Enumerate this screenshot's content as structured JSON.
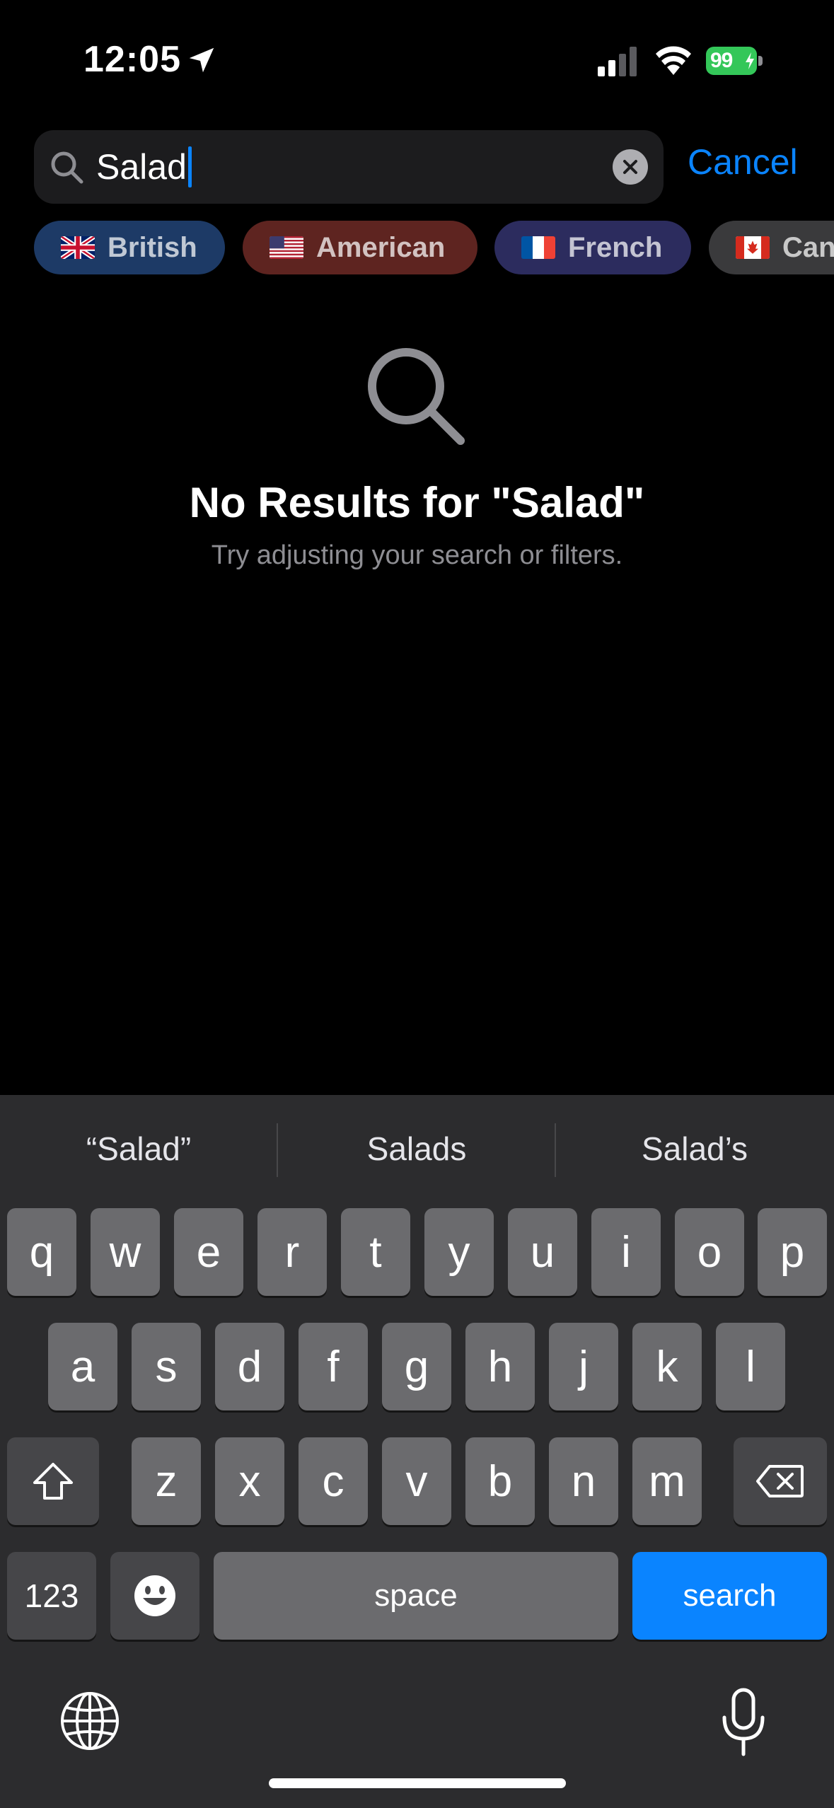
{
  "status_bar": {
    "time": "12:05",
    "battery": "99",
    "icons": [
      "location-arrow-icon",
      "cellular-signal-icon",
      "wifi-icon",
      "battery-charging-icon"
    ],
    "battery_color": "#34c759"
  },
  "search": {
    "value": "Salad",
    "cancel_label": "Cancel",
    "accent_color": "#0a84ff"
  },
  "filters": [
    {
      "label": "British",
      "flag": "uk-flag-icon",
      "color": "#1d3a66"
    },
    {
      "label": "American",
      "flag": "us-flag-icon",
      "color": "#5e2420"
    },
    {
      "label": "French",
      "flag": "france-flag-icon",
      "color": "#2c2c5e"
    },
    {
      "label": "Can",
      "flag": "canada-flag-icon",
      "color": "#3a3a3c"
    }
  ],
  "empty_state": {
    "title": "No Results for \"Salad\"",
    "subtitle": "Try adjusting your search or filters."
  },
  "keyboard": {
    "suggestions": [
      "“Salad”",
      "Salads",
      "Salad’s"
    ],
    "row1": [
      "q",
      "w",
      "e",
      "r",
      "t",
      "y",
      "u",
      "i",
      "o",
      "p"
    ],
    "row2": [
      "a",
      "s",
      "d",
      "f",
      "g",
      "h",
      "j",
      "k",
      "l"
    ],
    "row3": [
      "z",
      "x",
      "c",
      "v",
      "b",
      "n",
      "m"
    ],
    "numbers_label": "123",
    "space_label": "space",
    "search_label": "search"
  }
}
